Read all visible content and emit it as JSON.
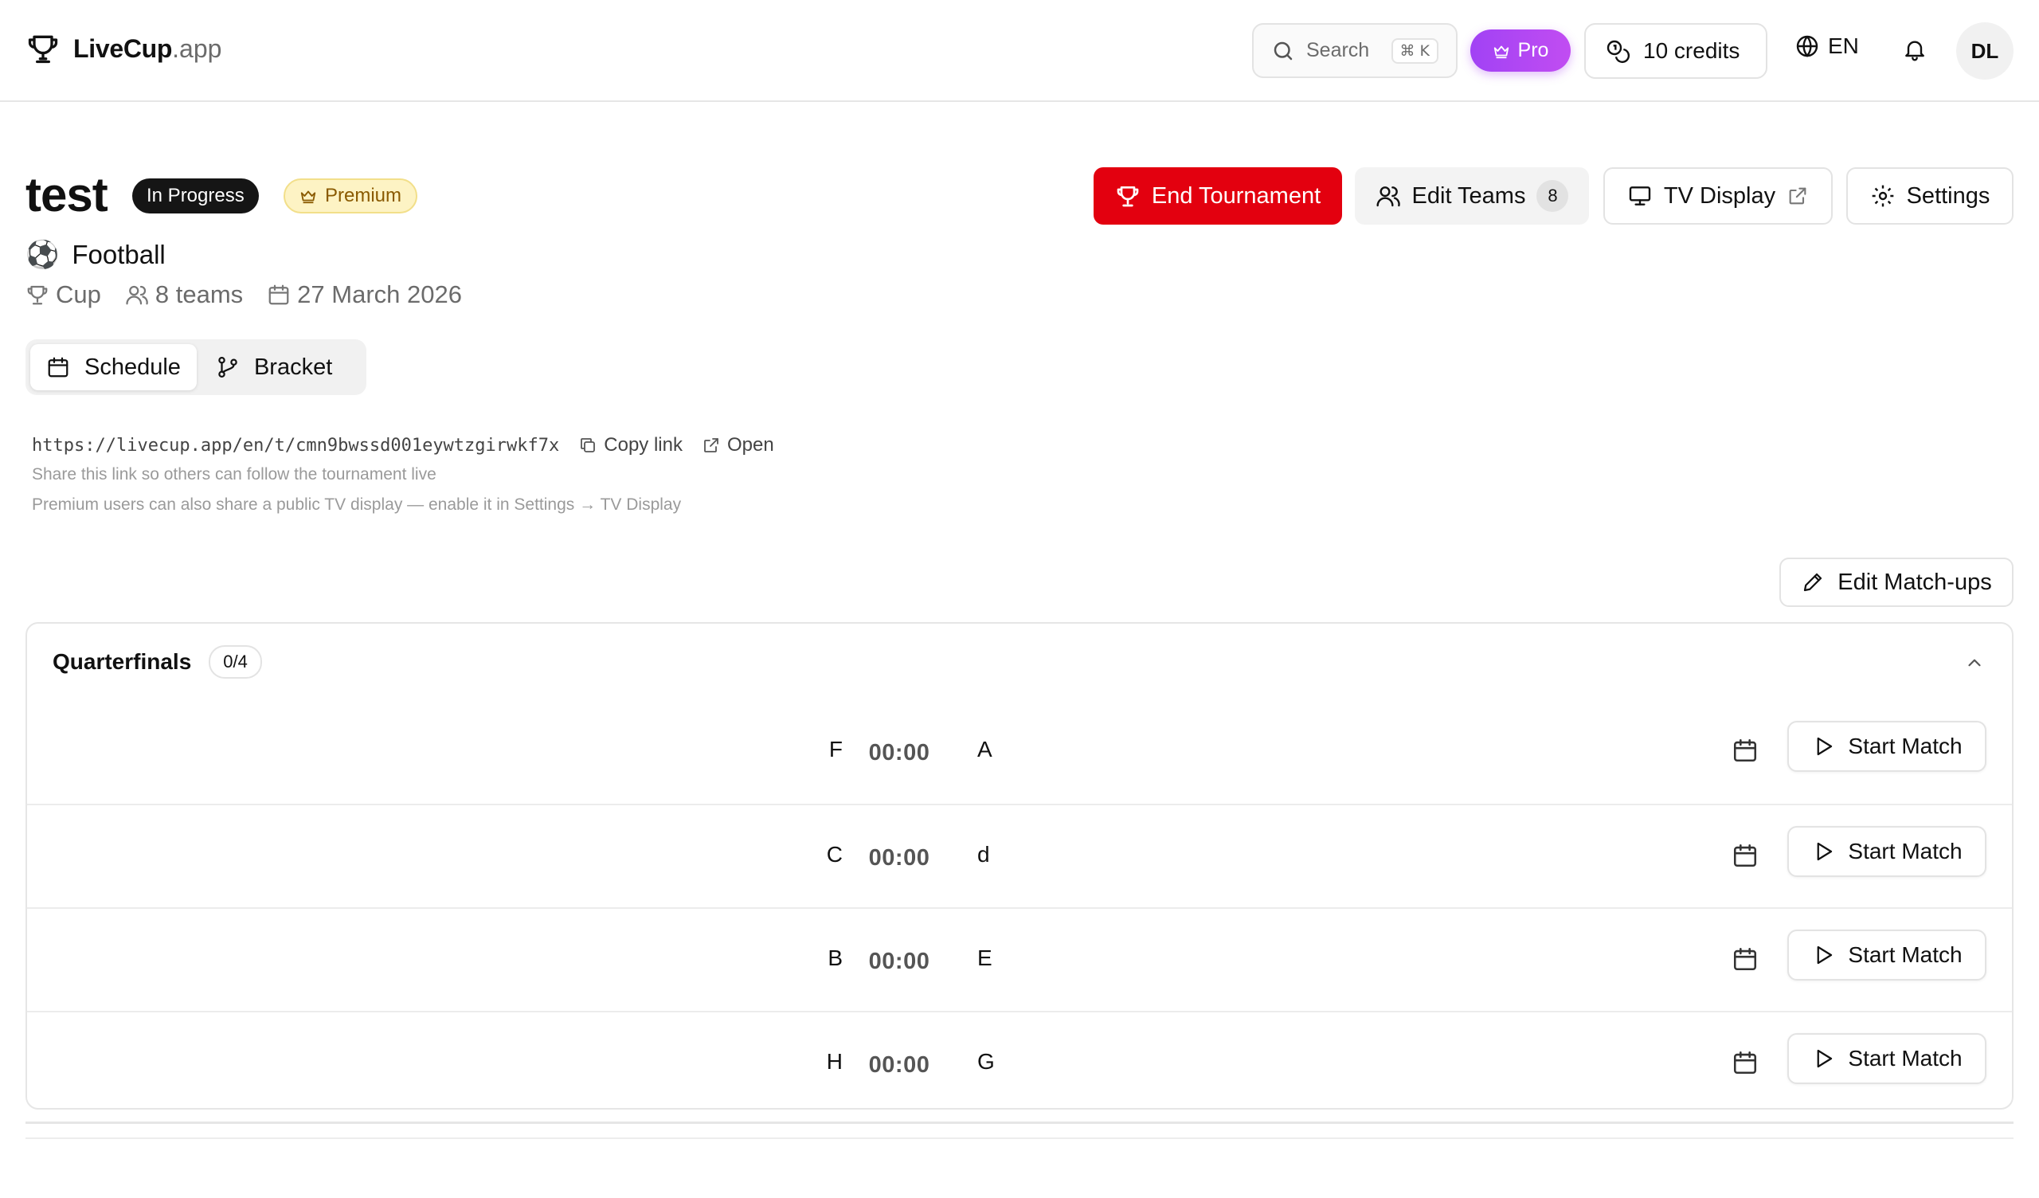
{
  "header": {
    "brand": "LiveCup",
    "brand_suffix": ".app",
    "search_label": "Search",
    "search_shortcut": "⌘ K",
    "pro_label": "Pro",
    "credits_label": "10 credits",
    "language": "EN",
    "avatar_initials": "DL"
  },
  "tournament": {
    "name": "test",
    "status": "In Progress",
    "tier": "Premium",
    "sport": "Football",
    "sport_emoji": "⚽",
    "format": "Cup",
    "teams_label": "8 teams",
    "date": "27 March 2026"
  },
  "actions": {
    "end_label": "End Tournament",
    "edit_teams_label": "Edit Teams",
    "team_count": "8",
    "tv_label": "TV Display",
    "settings_label": "Settings",
    "edit_matchups_label": "Edit Match-ups"
  },
  "views": {
    "schedule_label": "Schedule",
    "bracket_label": "Bracket",
    "active": "Schedule"
  },
  "share": {
    "url": "https://livecup.app/en/t/cmn9bwssd001eywtzgirwkf7x",
    "copy_label": "Copy link",
    "open_label": "Open",
    "hint": "Share this link so others can follow the tournament live",
    "premium_hint": "Premium users can also share a public TV display — enable it in Settings → TV Display"
  },
  "round": {
    "name": "Quarterfinals",
    "progress": "0/4",
    "start_label": "Start Match",
    "matches": [
      {
        "home": "F",
        "time": "00:00",
        "away": "A"
      },
      {
        "home": "C",
        "time": "00:00",
        "away": "d"
      },
      {
        "home": "B",
        "time": "00:00",
        "away": "E"
      },
      {
        "home": "H",
        "time": "00:00",
        "away": "G"
      }
    ]
  },
  "colors": {
    "end_button": "#e3000f",
    "pro_gradient_start": "#a142f4",
    "pro_gradient_end": "#c14df2",
    "status_badge": "#151515",
    "premium_badge": "#fdf3c4"
  }
}
